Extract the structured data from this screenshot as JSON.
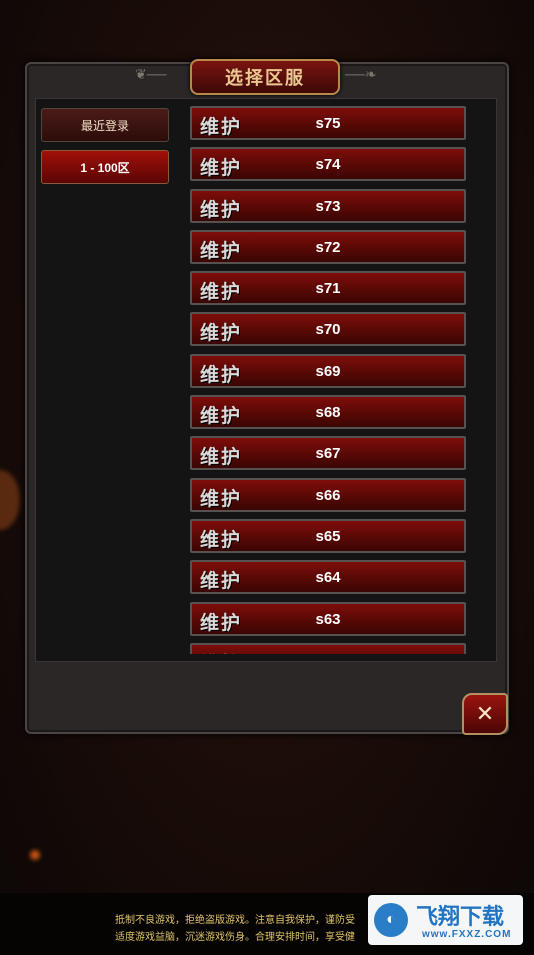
{
  "dialog": {
    "title": "选择区服",
    "close_symbol": "✕"
  },
  "tabs": [
    {
      "label": "最近登录"
    },
    {
      "label": "1 - 100区"
    }
  ],
  "servers": [
    {
      "status": "维护",
      "name": "s75"
    },
    {
      "status": "维护",
      "name": "s74"
    },
    {
      "status": "维护",
      "name": "s73"
    },
    {
      "status": "维护",
      "name": "s72"
    },
    {
      "status": "维护",
      "name": "s71"
    },
    {
      "status": "维护",
      "name": "s70"
    },
    {
      "status": "维护",
      "name": "s69"
    },
    {
      "status": "维护",
      "name": "s68"
    },
    {
      "status": "维护",
      "name": "s67"
    },
    {
      "status": "维护",
      "name": "s66"
    },
    {
      "status": "维护",
      "name": "s65"
    },
    {
      "status": "维护",
      "name": "s64"
    },
    {
      "status": "维护",
      "name": "s63"
    },
    {
      "status": "维护",
      "name": ""
    }
  ],
  "footer": {
    "line1": "抵制不良游戏，拒绝盗版游戏。注意自我保护，谨防受",
    "line2": "适度游戏益脑，沉迷游戏伤身。合理安排时间，享受健"
  },
  "watermark": {
    "main": "飞翔下载",
    "sub": "www.FXXZ.COM"
  },
  "colors": {
    "accent_red": "#7e0d0a",
    "gold": "#b78a4c"
  }
}
